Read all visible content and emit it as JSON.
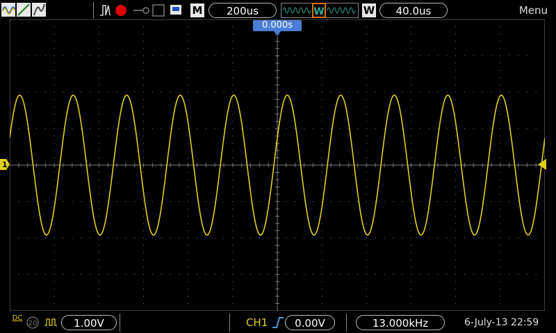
{
  "top": {
    "run_state_icon": "stop-record-icon",
    "mode_label": "M",
    "timebase": "200us",
    "window_label": "W",
    "window_marker": "W",
    "window_timebase": "40.0us",
    "menu_label": "Menu"
  },
  "trigger_position": "0.000s",
  "channel_marker": "1",
  "bottom": {
    "coupling": "DC",
    "bw_limit": "20",
    "vdiv": "1.00V",
    "trig_channel": "CH1",
    "trig_level": "0.00V",
    "frequency": "13.000kHz",
    "datetime": "6-July-13 22:59"
  },
  "colors": {
    "ch1": "#e0d020",
    "grid": "#7a7a7a",
    "trigger": "#4a7ed6",
    "record": "#e00000"
  },
  "waveform": {
    "type": "sine",
    "cycles_on_screen": 10,
    "amplitude_div": 2.0
  }
}
